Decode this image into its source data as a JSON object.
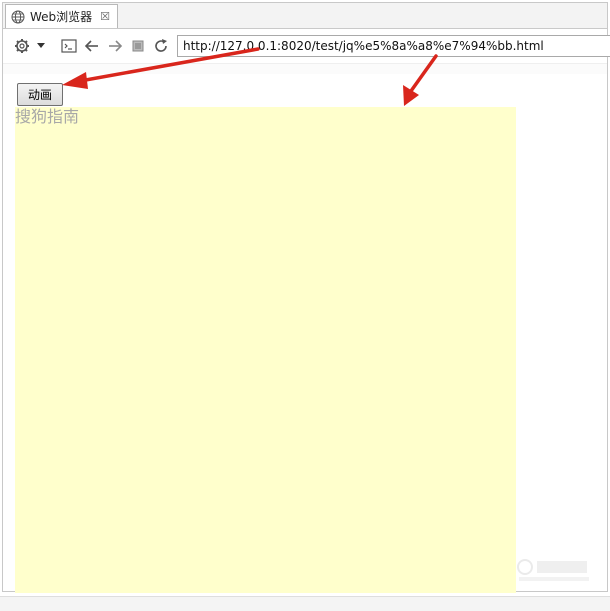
{
  "tab": {
    "title": "Web浏览器",
    "close_glyph": "☒"
  },
  "toolbar": {
    "icons": [
      "gear-icon",
      "dropdown-arrow-icon",
      "console-icon",
      "back-icon",
      "forward-icon",
      "stop-icon",
      "reload-icon"
    ],
    "url": "http://127.0.0.1:8020/test/jq%e5%8a%a8%e7%94%bb.html"
  },
  "page": {
    "button_label": "动画",
    "box_text": "搜狗指南",
    "box_color": "#ffffcc"
  },
  "annotations": {
    "arrow_color": "#d9261c"
  }
}
